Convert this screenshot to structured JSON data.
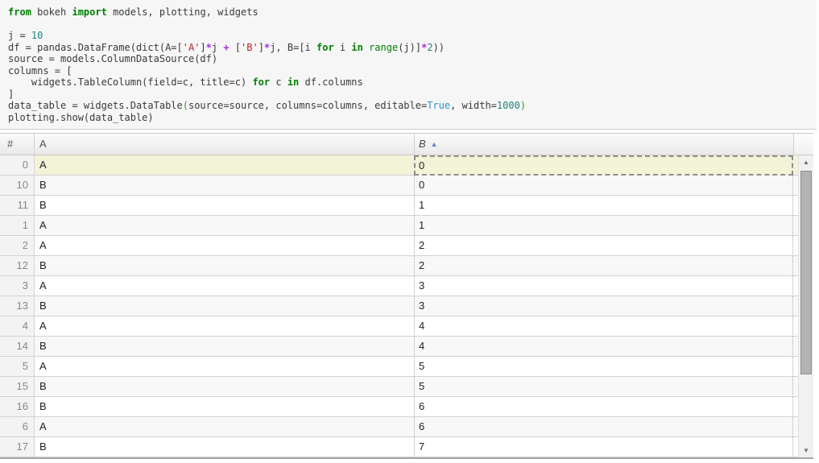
{
  "code": {
    "lines": [
      {
        "tokens": [
          {
            "t": "from",
            "c": "k"
          },
          {
            "t": " bokeh ",
            "c": "p"
          },
          {
            "t": "import",
            "c": "k"
          },
          {
            "t": " models, plotting, widgets",
            "c": "p"
          }
        ]
      },
      {
        "tokens": []
      },
      {
        "tokens": [
          {
            "t": "j = ",
            "c": "p"
          },
          {
            "t": "10",
            "c": "n"
          }
        ]
      },
      {
        "tokens": [
          {
            "t": "df = pandas.DataFrame(dict(A=[",
            "c": "p"
          },
          {
            "t": "'A'",
            "c": "s"
          },
          {
            "t": "]",
            "c": "p"
          },
          {
            "t": "*",
            "c": "o"
          },
          {
            "t": "j ",
            "c": "p"
          },
          {
            "t": "+",
            "c": "o"
          },
          {
            "t": " [",
            "c": "p"
          },
          {
            "t": "'B'",
            "c": "s"
          },
          {
            "t": "]",
            "c": "p"
          },
          {
            "t": "*",
            "c": "o"
          },
          {
            "t": "j, B=[i ",
            "c": "p"
          },
          {
            "t": "for",
            "c": "k"
          },
          {
            "t": " i ",
            "c": "p"
          },
          {
            "t": "in",
            "c": "k"
          },
          {
            "t": " ",
            "c": "p"
          },
          {
            "t": "range",
            "c": "b"
          },
          {
            "t": "(j)]",
            "c": "p"
          },
          {
            "t": "*",
            "c": "o"
          },
          {
            "t": "2",
            "c": "n"
          },
          {
            "t": "))",
            "c": "p"
          }
        ]
      },
      {
        "tokens": [
          {
            "t": "source = models.ColumnDataSource(df)",
            "c": "p"
          }
        ]
      },
      {
        "tokens": [
          {
            "t": "columns = [",
            "c": "p"
          }
        ]
      },
      {
        "tokens": [
          {
            "t": "    widgets.TableColumn(field=c, title=c) ",
            "c": "p"
          },
          {
            "t": "for",
            "c": "k"
          },
          {
            "t": " c ",
            "c": "p"
          },
          {
            "t": "in",
            "c": "k"
          },
          {
            "t": " df.columns",
            "c": "p"
          }
        ]
      },
      {
        "tokens": [
          {
            "t": "]",
            "c": "p"
          }
        ]
      },
      {
        "tokens": [
          {
            "t": "data_table = widgets.DataTable",
            "c": "p"
          },
          {
            "t": "(",
            "c": "g"
          },
          {
            "t": "source=source, columns=columns, editable=",
            "c": "p"
          },
          {
            "t": "True",
            "c": "c"
          },
          {
            "t": ", width=",
            "c": "p"
          },
          {
            "t": "1000",
            "c": "n"
          },
          {
            "t": ")",
            "c": "g"
          }
        ]
      },
      {
        "tokens": [
          {
            "t": "plotting.show(data_table)",
            "c": "p"
          }
        ]
      }
    ]
  },
  "table": {
    "header": {
      "index_label": "#",
      "col_a_label": "A",
      "col_b_label": "B",
      "sort_column": "B",
      "sort_direction": "ascending",
      "sort_icon": "▲"
    },
    "rows": [
      {
        "index": "0",
        "a": "A",
        "b": "0",
        "selected": true,
        "active_cell": "b"
      },
      {
        "index": "10",
        "a": "B",
        "b": "0"
      },
      {
        "index": "11",
        "a": "B",
        "b": "1"
      },
      {
        "index": "1",
        "a": "A",
        "b": "1"
      },
      {
        "index": "2",
        "a": "A",
        "b": "2"
      },
      {
        "index": "12",
        "a": "B",
        "b": "2"
      },
      {
        "index": "3",
        "a": "A",
        "b": "3"
      },
      {
        "index": "13",
        "a": "B",
        "b": "3"
      },
      {
        "index": "4",
        "a": "A",
        "b": "4"
      },
      {
        "index": "14",
        "a": "B",
        "b": "4"
      },
      {
        "index": "5",
        "a": "A",
        "b": "5"
      },
      {
        "index": "15",
        "a": "B",
        "b": "5"
      },
      {
        "index": "16",
        "a": "B",
        "b": "6"
      },
      {
        "index": "6",
        "a": "A",
        "b": "6"
      },
      {
        "index": "17",
        "a": "B",
        "b": "7"
      }
    ]
  },
  "scrollbar": {
    "up_icon": "▲",
    "down_icon": "▼"
  },
  "colors": {
    "selected_row_bg": "#f3f3d8",
    "sort_arrow": "#5d87c8",
    "keyword_green": "#008000",
    "string_red": "#ba2121",
    "number_teal": "#1f8080",
    "operator_purple": "#a22fe0"
  }
}
